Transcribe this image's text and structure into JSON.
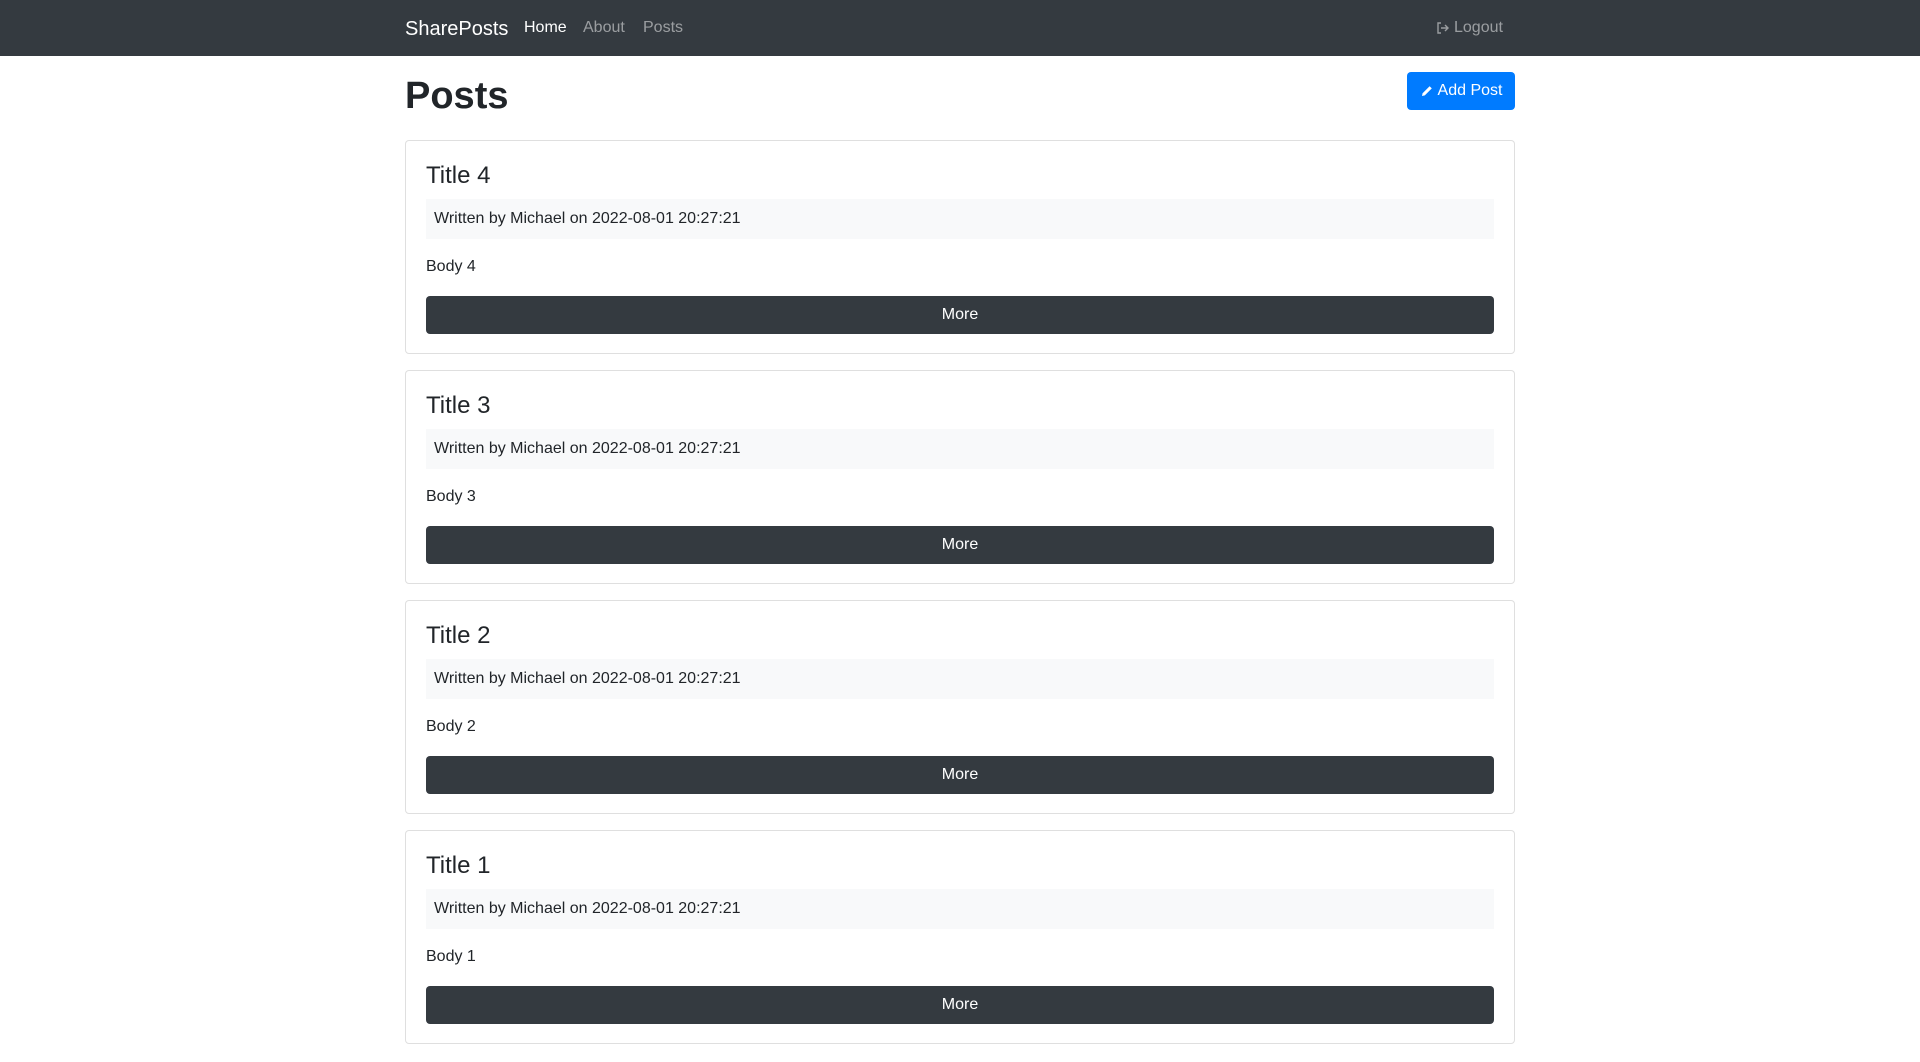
{
  "navbar": {
    "brand": "SharePosts",
    "links": [
      {
        "label": "Home",
        "active": true
      },
      {
        "label": "About",
        "active": false
      },
      {
        "label": "Posts",
        "active": false
      }
    ],
    "logout_label": "Logout",
    "logout_icon": "sign-out-icon"
  },
  "page": {
    "title": "Posts",
    "add_post_label": "Add Post",
    "add_post_icon": "pencil-icon"
  },
  "colors": {
    "navbar_bg": "#343a40",
    "primary": "#007bff",
    "dark_button": "#343a40",
    "meta_bg": "#f8f9fa"
  },
  "posts": [
    {
      "title": "Title 4",
      "meta": "Written by Michael on 2022-08-01 20:27:21",
      "body": "Body 4",
      "more_label": "More"
    },
    {
      "title": "Title 3",
      "meta": "Written by Michael on 2022-08-01 20:27:21",
      "body": "Body 3",
      "more_label": "More"
    },
    {
      "title": "Title 2",
      "meta": "Written by Michael on 2022-08-01 20:27:21",
      "body": "Body 2",
      "more_label": "More"
    },
    {
      "title": "Title 1",
      "meta": "Written by Michael on 2022-08-01 20:27:21",
      "body": "Body 1",
      "more_label": "More"
    }
  ]
}
